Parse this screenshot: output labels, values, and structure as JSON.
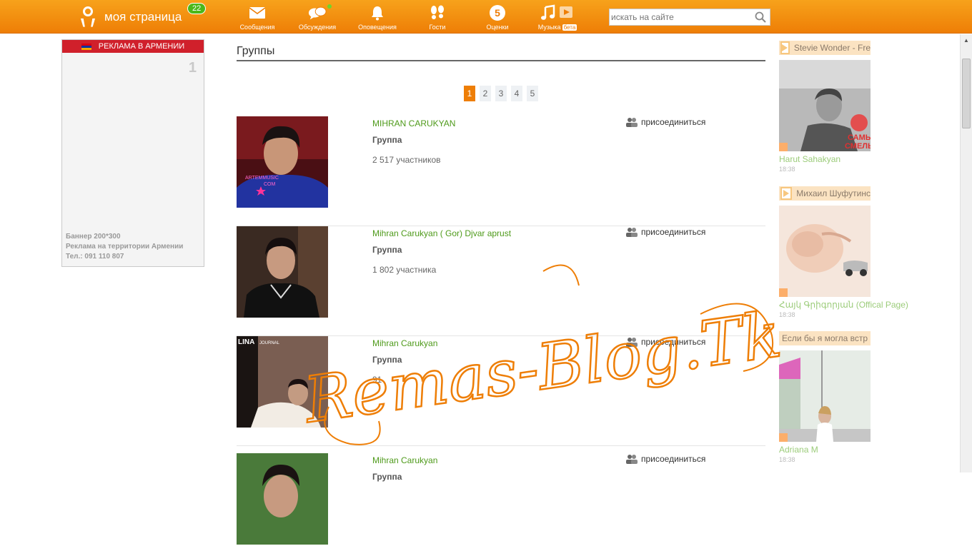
{
  "header": {
    "title": "моя страница",
    "badge": "22",
    "nav": [
      {
        "label": "Сообщения",
        "icon": "envelope-icon"
      },
      {
        "label": "Обсуждения",
        "icon": "chat-bubbles-icon"
      },
      {
        "label": "Оповещения",
        "icon": "bell-icon"
      },
      {
        "label": "Гости",
        "icon": "footprints-icon"
      },
      {
        "label": "Оценки",
        "icon": "rating-five-icon"
      },
      {
        "label": "Музыка",
        "icon": "music-note-icon",
        "badge": "бета"
      }
    ],
    "search_placeholder": "искать на сайте"
  },
  "ad": {
    "header": "РЕКЛАМА В АРМЕНИИ",
    "number": "1",
    "line1": "Баннер 200*300",
    "line2": "Реклама на территории Армении",
    "line3": "Тел.: 091 110 807"
  },
  "main": {
    "title": "Группы",
    "pages": [
      "1",
      "2",
      "3",
      "4",
      "5"
    ],
    "active_page": "1",
    "join_label": "присоединиться",
    "groups": [
      {
        "name": "MIHRAN CARUKYAN",
        "type": "Группа",
        "members": "2 517 участников"
      },
      {
        "name": "Mihran Carukyan ( Gor) Djvar aprust",
        "type": "Группа",
        "members": "1 802 участника"
      },
      {
        "name": "Mihran Carukyan",
        "type": "Группа",
        "members": "91"
      },
      {
        "name": "Mihran Carukyan",
        "type": "Группа",
        "members": ""
      }
    ]
  },
  "right": [
    {
      "title": "Stevie Wonder - Fre",
      "name": "Harut Sahakyan",
      "time": "18:38"
    },
    {
      "title": "Михаил Шуфутинс",
      "name": "Հայկ Գրիգորյան (Offical Page)",
      "time": "18:38"
    },
    {
      "title": "Если бы я могла встр",
      "name": "Adriana M",
      "time": "18:38"
    }
  ],
  "thumb_text": {
    "lina": "LINA",
    "journal": "JOURNAL",
    "shirt": "ARTEMMUSIC",
    "com": "COM",
    "brand1": "САМЫЙ",
    "brand2": "СМЕЛЫЙ"
  },
  "watermark": "Remas-Blog.Tk",
  "colors": {
    "brand": "#ee7e06",
    "link": "#4e9a1a",
    "ad_header": "#d0202b"
  }
}
